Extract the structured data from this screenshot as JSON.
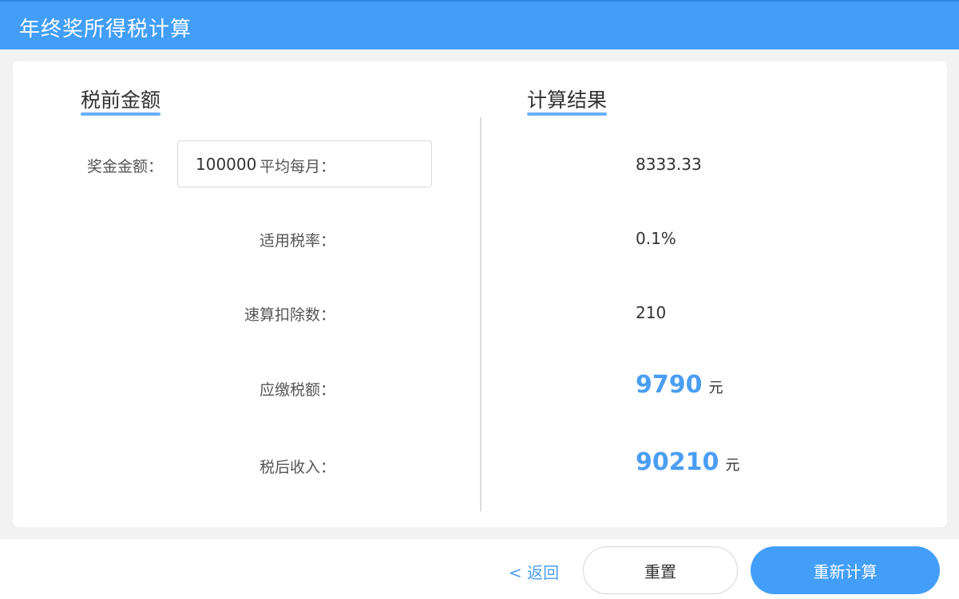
{
  "header": {
    "title": "年终奖所得税计算"
  },
  "pre_tax": {
    "title": "税前金额",
    "bonus_label": "奖金金额：",
    "bonus_value": "100000"
  },
  "result": {
    "title": "计算结果",
    "monthly_avg": {
      "label": "平均每月：",
      "value": "8333.33"
    },
    "tax_rate": {
      "label": "适用税率：",
      "value": "0.1%"
    },
    "quick_deduction": {
      "label": "速算扣除数：",
      "value": "210"
    },
    "tax_payable": {
      "label": "应缴税额：",
      "value": "9790",
      "unit": "元"
    },
    "after_tax_income": {
      "label": "税后收入：",
      "value": "90210",
      "unit": "元"
    }
  },
  "footer": {
    "back_label": "< 返回",
    "reset_label": "重置",
    "recalculate_label": "重新计算"
  },
  "colors": {
    "accent": "#429ef9",
    "highlight_value": "#4a9ef2"
  }
}
